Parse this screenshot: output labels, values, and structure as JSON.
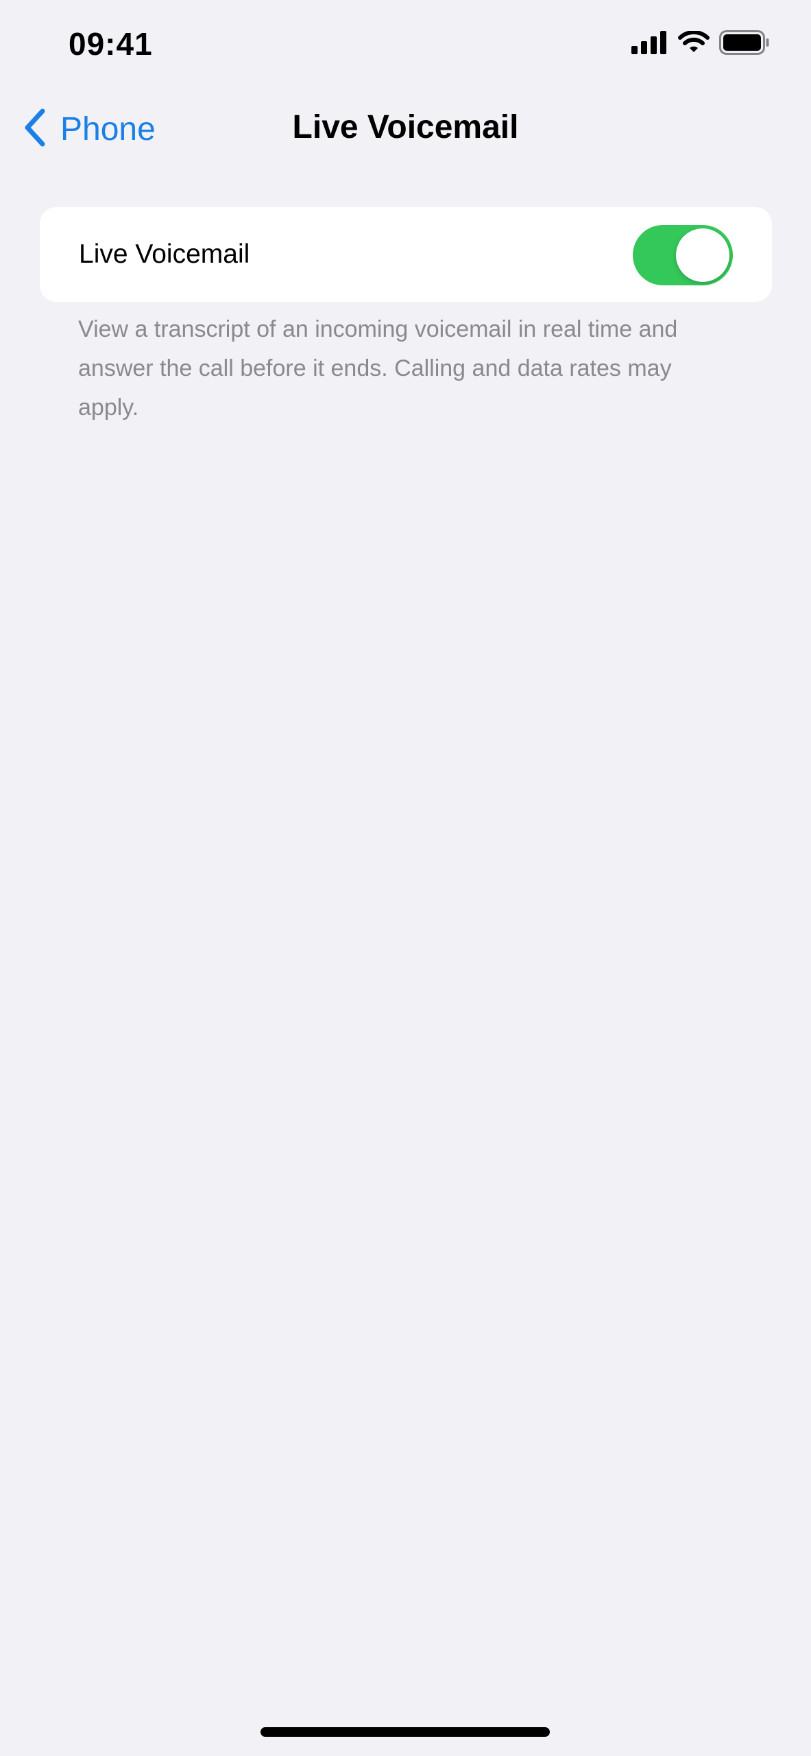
{
  "status_bar": {
    "time": "09:41",
    "icons": [
      "cellular-signal-icon",
      "wifi-icon",
      "battery-icon"
    ]
  },
  "nav": {
    "back_label": "Phone",
    "title": "Live Voicemail"
  },
  "settings": {
    "live_voicemail": {
      "label": "Live Voicemail",
      "enabled": true
    },
    "footer": "View a transcript of an incoming voicemail in real time and answer the call before it ends. Calling and data rates may apply."
  },
  "colors": {
    "background": "#f1f1f6",
    "accent": "#1a80e5",
    "toggle_on": "#34c759",
    "secondary_text": "#8a8a8e"
  }
}
